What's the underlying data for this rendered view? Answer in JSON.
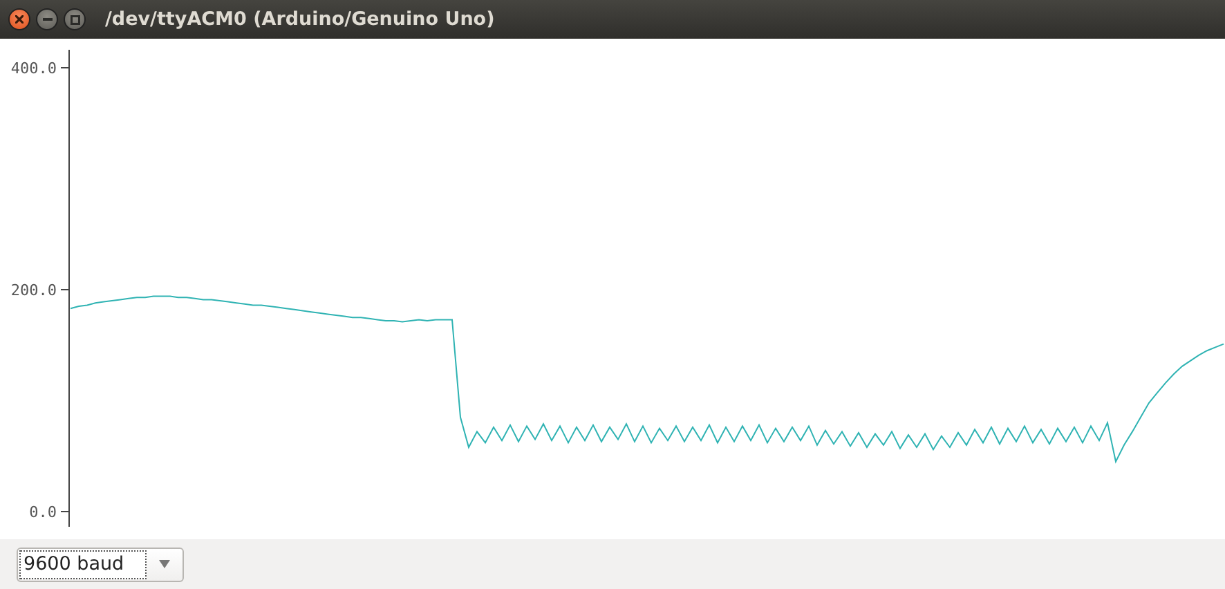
{
  "window": {
    "title": "/dev/ttyACM0 (Arduino/Genuino Uno)"
  },
  "plotter": {
    "chart_data": {
      "type": "line",
      "ylim": [
        -13.7,
        416.2
      ],
      "yticks": [
        {
          "value": 0,
          "label": "0.0"
        },
        {
          "value": 200,
          "label": "200.0"
        },
        {
          "value": 400,
          "label": "400.0"
        }
      ],
      "series": [
        {
          "color": "#2fb3b3",
          "values": [
            183,
            185,
            186,
            188,
            189,
            190,
            191,
            192,
            193,
            193,
            194,
            194,
            194,
            193,
            193,
            192,
            191,
            191,
            190,
            189,
            188,
            187,
            186,
            186,
            185,
            184,
            183,
            182,
            181,
            180,
            179,
            178,
            177,
            176,
            175,
            175,
            174,
            173,
            172,
            172,
            171,
            172,
            173,
            172,
            173,
            173,
            173,
            85,
            58,
            72,
            62,
            76,
            64,
            78,
            63,
            77,
            65,
            79,
            64,
            77,
            62,
            76,
            64,
            78,
            63,
            76,
            65,
            79,
            63,
            77,
            62,
            75,
            64,
            77,
            63,
            76,
            64,
            78,
            62,
            76,
            63,
            77,
            64,
            78,
            62,
            75,
            63,
            76,
            64,
            77,
            60,
            73,
            61,
            72,
            59,
            71,
            58,
            70,
            60,
            72,
            57,
            69,
            58,
            70,
            56,
            68,
            58,
            71,
            60,
            74,
            62,
            76,
            61,
            75,
            63,
            77,
            62,
            74,
            61,
            75,
            63,
            76,
            62,
            77,
            64,
            80,
            45,
            60,
            72,
            85,
            98,
            107,
            116,
            124,
            131,
            136,
            141,
            145,
            148,
            151
          ]
        }
      ]
    }
  },
  "baud_select": {
    "value": "9600 baud"
  }
}
